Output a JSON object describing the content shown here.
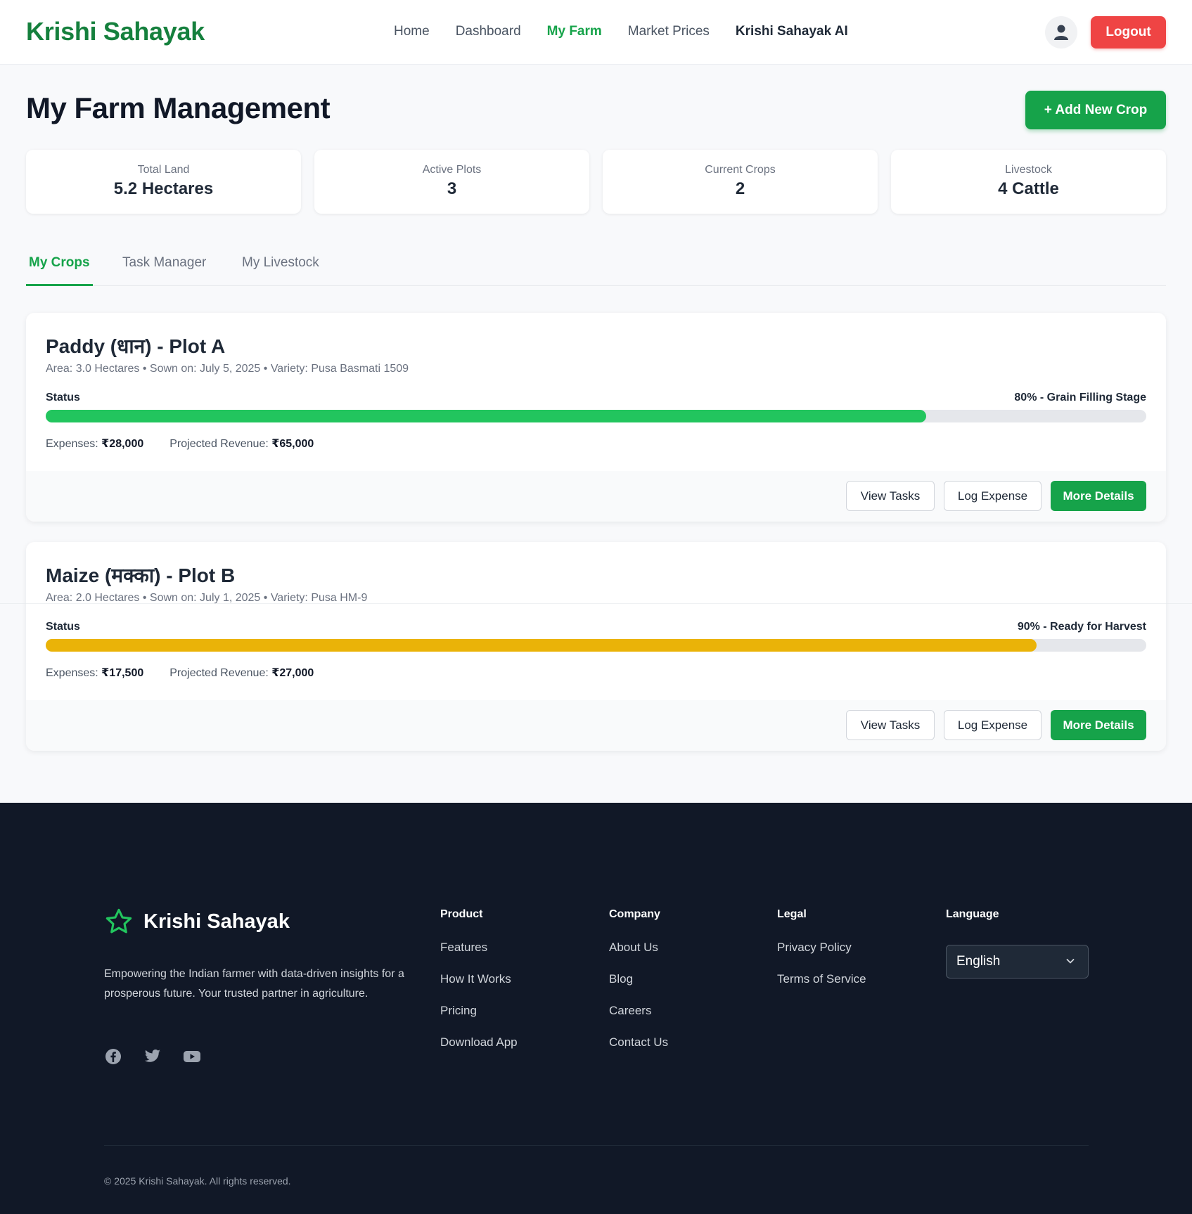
{
  "header": {
    "brand": "Krishi Sahayak",
    "nav": [
      {
        "label": "Home"
      },
      {
        "label": "Dashboard"
      },
      {
        "label": "My Farm"
      },
      {
        "label": "Market Prices"
      },
      {
        "label": "Krishi Sahayak AI"
      }
    ],
    "active_nav": "My Farm",
    "logout_label": "Logout"
  },
  "page": {
    "title": "My Farm Management",
    "add_crop_label": "+ Add New Crop"
  },
  "stats": [
    {
      "label": "Total Land",
      "value": "5.2 Hectares"
    },
    {
      "label": "Active Plots",
      "value": "3"
    },
    {
      "label": "Current Crops",
      "value": "2"
    },
    {
      "label": "Livestock",
      "value": "4 Cattle"
    }
  ],
  "tabs": [
    {
      "label": "My Crops"
    },
    {
      "label": "Task Manager"
    },
    {
      "label": "My Livestock"
    }
  ],
  "active_tab": "My Crops",
  "crops": [
    {
      "title": "Paddy (धान) - Plot A",
      "meta": "Area: 3.0 Hectares • Sown on: July 5, 2025 • Variety: Pusa Basmati 1509",
      "status_label": "Status",
      "status_text": "80% - Grain Filling Stage",
      "progress": 0.8,
      "bar_color": "#22c55e",
      "expenses_label": "Expenses:",
      "expenses": "₹28,000",
      "revenue_label": "Projected Revenue:",
      "revenue": "₹65,000",
      "btn_tasks": "View Tasks",
      "btn_expense": "Log Expense",
      "btn_details": "More Details"
    },
    {
      "title": "Maize (मक्का) - Plot B",
      "meta": "Area: 2.0 Hectares • Sown on: July 1, 2025 • Variety: Pusa HM-9",
      "status_label": "Status",
      "status_text": "90% - Ready for Harvest",
      "progress": 0.9,
      "bar_color": "#eab308",
      "expenses_label": "Expenses:",
      "expenses": "₹17,500",
      "revenue_label": "Projected Revenue:",
      "revenue": "₹27,000",
      "btn_tasks": "View Tasks",
      "btn_expense": "Log Expense",
      "btn_details": "More Details"
    }
  ],
  "footer": {
    "brand": "Krishi Sahayak",
    "description": "Empowering the Indian farmer with data-driven insights for a prosperous future. Your trusted partner in agriculture.",
    "socials": [
      "facebook-icon",
      "twitter-icon",
      "youtube-icon"
    ],
    "columns": [
      {
        "heading": "Product",
        "links": [
          "Features",
          "How It Works",
          "Pricing",
          "Download App"
        ]
      },
      {
        "heading": "Company",
        "links": [
          "About Us",
          "Blog",
          "Careers",
          "Contact Us"
        ]
      },
      {
        "heading": "Legal",
        "links": [
          "Privacy Policy",
          "Terms of Service"
        ]
      }
    ],
    "language_heading": "Language",
    "language_selected": "English",
    "copyright": "© 2025 Krishi Sahayak. All rights reserved."
  },
  "colors": {
    "brand_green": "#15803d",
    "accent_green": "#16a34a",
    "logout_red": "#ef4444",
    "footer_bg": "#111827"
  }
}
